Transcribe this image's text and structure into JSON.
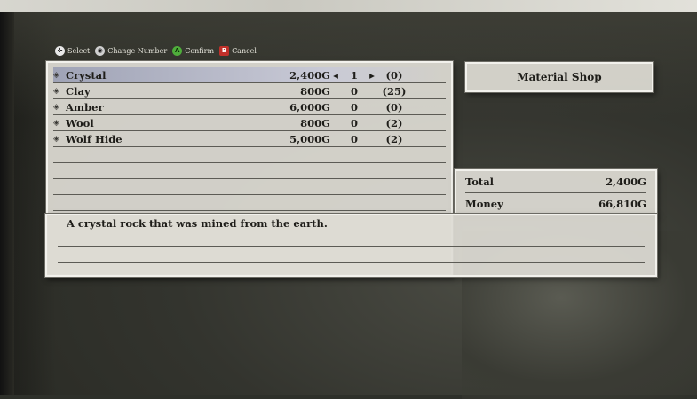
{
  "controls": [
    {
      "icon": "dpad-select-icon",
      "label": "Select"
    },
    {
      "icon": "stick-change-icon",
      "label": "Change Number"
    },
    {
      "icon": "a-button-icon",
      "label": "Confirm"
    },
    {
      "icon": "b-button-icon",
      "label": "Cancel"
    }
  ],
  "items": [
    {
      "name": "Crystal",
      "price": "2,400G",
      "qty": "1",
      "owned": "(0)",
      "selected": true
    },
    {
      "name": "Clay",
      "price": "800G",
      "qty": "0",
      "owned": "(25)"
    },
    {
      "name": "Amber",
      "price": "6,000G",
      "qty": "0",
      "owned": "(0)"
    },
    {
      "name": "Wool",
      "price": "800G",
      "qty": "0",
      "owned": "(2)"
    },
    {
      "name": "Wolf Hide",
      "price": "5,000G",
      "qty": "0",
      "owned": "(2)"
    }
  ],
  "shop": {
    "title": "Material Shop"
  },
  "totals": {
    "total_label": "Total",
    "total_value": "2,400G",
    "money_label": "Money",
    "money_value": "66,810G"
  },
  "description": "A crystal rock that was mined from the earth.",
  "colors": {
    "panel": "#dedcd4",
    "selected_row": "#9fa3b6",
    "confirm": "#4fae3b",
    "cancel": "#c0302a"
  }
}
